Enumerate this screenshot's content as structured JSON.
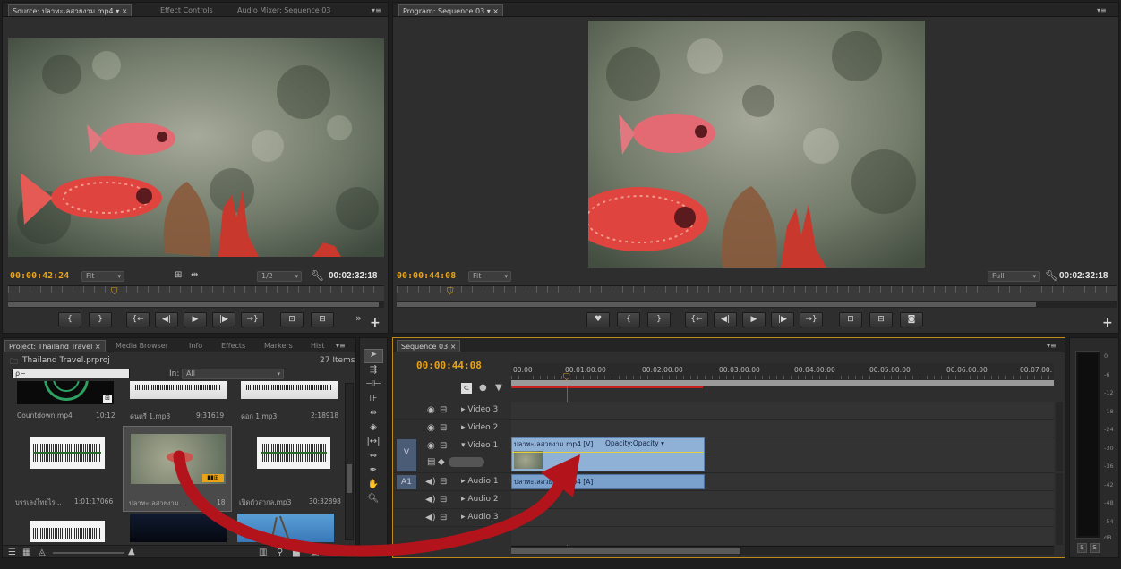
{
  "source": {
    "tabs": [
      "Source: ปลาทะเลสวยงาม.mp4",
      "Effect Controls",
      "Audio Mixer: Sequence 03"
    ],
    "timecode_current": "00:00:42:24",
    "zoom": "Fit",
    "resolution": "1/2",
    "timecode_duration": "00:02:32:18"
  },
  "program": {
    "tab": "Program: Sequence 03",
    "timecode_current": "00:00:44:08",
    "zoom": "Fit",
    "resolution": "Full",
    "timecode_duration": "00:02:32:18"
  },
  "project": {
    "tabs": [
      "Project: Thailand Travel",
      "Media Browser",
      "Info",
      "Effects",
      "Markers",
      "Hist"
    ],
    "file_name": "Thailand Travel.prproj",
    "item_count": "27 Items",
    "search_placeholder": "ρ~",
    "in_label": "In:",
    "in_value": "All",
    "items": [
      {
        "name": "Countdown.mp4",
        "duration": "10:12",
        "kind": "countdown"
      },
      {
        "name": "ดนตรี 1.mp3",
        "duration": "9:31619",
        "kind": "audio"
      },
      {
        "name": "ดอก 1.mp3",
        "duration": "2:18918",
        "kind": "audio"
      },
      {
        "name": "บรรเลงไทยไร...",
        "duration": "1:01:17066",
        "kind": "audio"
      },
      {
        "name": "ปลาทะเลสวยงาม...",
        "duration": "18",
        "kind": "video"
      },
      {
        "name": "เปิดตัวสากล.mp3",
        "duration": "30:32898",
        "kind": "audio"
      },
      {
        "name": "",
        "duration": "",
        "kind": "audio"
      },
      {
        "name": "",
        "duration": "",
        "kind": "dark"
      },
      {
        "name": "",
        "duration": "",
        "kind": "sky"
      }
    ]
  },
  "sequence": {
    "tab": "Sequence 03",
    "timecode": "00:00:44:08",
    "ruler_labels": [
      "00:00",
      "00:01:00:00",
      "00:02:00:00",
      "00:03:00:00",
      "00:04:00:00",
      "00:05:00:00",
      "00:06:00:00",
      "00:07:00:"
    ],
    "tracks": [
      {
        "label": "Video 3",
        "type": "video"
      },
      {
        "label": "Video 2",
        "type": "video"
      },
      {
        "label": "Video 1",
        "type": "video",
        "expanded": true,
        "target": "V"
      },
      {
        "label": "Audio 1",
        "type": "audio",
        "target": "A1"
      },
      {
        "label": "Audio 2",
        "type": "audio"
      },
      {
        "label": "Audio 3",
        "type": "audio"
      }
    ],
    "video_clip_label": "ปลาทะเลสวยงาม.mp4 [V]",
    "opacity_label": "Opacity:Opacity",
    "audio_clip_label": "ปลาทะเลสวยงาม.mp4 [A]"
  },
  "meters": {
    "scale": [
      "0",
      "-6",
      "-12",
      "-18",
      "-24",
      "-30",
      "-36",
      "-42",
      "-48",
      "-54",
      "dB"
    ],
    "solo": [
      "S",
      "S"
    ]
  },
  "colors": {
    "timecode": "#e8a317",
    "clip_video": "#8fb1d6",
    "clip_audio": "#7aa0cc",
    "arrow": "#b3141b",
    "playhead": "#d63a2a"
  },
  "icons": {
    "wrench": "wrench-icon",
    "add": "add-icon",
    "eye": "eye-icon",
    "speaker": "speaker-icon"
  }
}
